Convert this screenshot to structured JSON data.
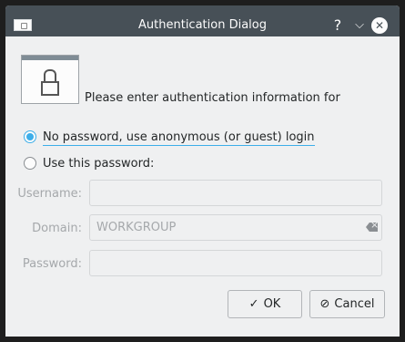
{
  "window": {
    "title": "Authentication Dialog",
    "help_glyph": "?",
    "minimize_glyph": "⌵",
    "close_glyph": "✕"
  },
  "intro": "Please enter authentication information for",
  "options": {
    "anonymous_label": "No password, use anonymous (or guest) login",
    "anonymous_checked": true,
    "password_label": "Use this password:",
    "password_checked": false
  },
  "fields": {
    "username_label": "Username:",
    "username_value": "",
    "domain_label": "Domain:",
    "domain_value": "WORKGROUP",
    "password_label": "Password:",
    "password_value": ""
  },
  "buttons": {
    "ok_label": "OK",
    "ok_icon": "✓",
    "cancel_label": "Cancel",
    "cancel_icon": "⊘"
  },
  "colors": {
    "accent": "#3daee9",
    "titlebar": "#475057",
    "window_bg": "#eff0f1"
  }
}
